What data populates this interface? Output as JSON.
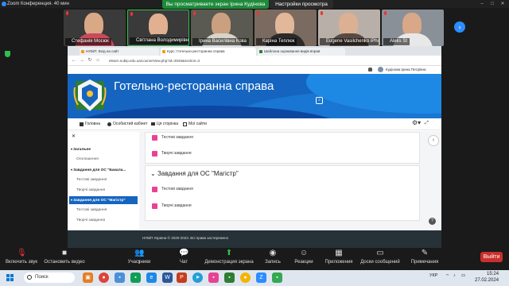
{
  "zoom": {
    "window_title": "Zoom Конференция. 40 мин",
    "share_banner": "Вы просматриваете экран Ірина Кудінова",
    "view_options": "Настройки просмотра"
  },
  "participants": [
    {
      "name": "Стефанія Мосюк",
      "muted": true
    },
    {
      "name": "Світлана Володимирівна",
      "muted": true
    },
    {
      "name": "Ірина Василівна Кова",
      "muted": true
    },
    {
      "name": "Каріна Теплюк",
      "muted": true
    },
    {
      "name": "Eugene Vasilchenko iPho...",
      "muted": true
    },
    {
      "name": "Aleks St",
      "muted": true
    }
  ],
  "browser": {
    "tabs": [
      "НУБіП: Вхід на сайт",
      "Курс: Готельно-ресторанна справа",
      "Шаблони оцінювання видів вправ"
    ],
    "url": "elearn.nubip.edu.ua/course/view.php?id=3545&section=2",
    "user_name": "Кудінова Ірина Петрівна"
  },
  "course": {
    "title": "Готельно-ресторанна справа",
    "nav": [
      "Головна",
      "Особистий кабінет",
      "Ця сторінка",
      "Мої сайти"
    ],
    "drawer": [
      {
        "label": "Загальне",
        "type": "sec"
      },
      {
        "label": "Оголошення",
        "type": "sub"
      },
      {
        "label": "Завдання для ОС \"Бакала...",
        "type": "sec"
      },
      {
        "label": "Тестові завдання",
        "type": "sub"
      },
      {
        "label": "Творчі завдання",
        "type": "sub"
      },
      {
        "label": "Завдання для ОС \"Магістр\"",
        "type": "active"
      },
      {
        "label": "Тестові завдання",
        "type": "sub"
      },
      {
        "label": "Творчі завдання",
        "type": "sub"
      }
    ],
    "activities_top": [
      "Тестові завдання",
      "Творчі завдання"
    ],
    "section_title": "Завдання для ОС \"Магістр\"",
    "activities_bottom": [
      "Тестові завдання",
      "Творчі завдання"
    ],
    "footer": "НУБіП України © 2020-2023. Всі права застережено"
  },
  "toolbar": {
    "items": [
      {
        "label": "Включить звук",
        "icon": "mic-muted-icon"
      },
      {
        "label": "Остановить видео",
        "icon": "video-icon"
      },
      {
        "label": "Участники",
        "icon": "participants-icon",
        "count": "9"
      },
      {
        "label": "Чат",
        "icon": "chat-icon"
      },
      {
        "label": "Демонстрация экрана",
        "icon": "share-screen-icon"
      },
      {
        "label": "Запись",
        "icon": "record-icon"
      },
      {
        "label": "Реакции",
        "icon": "reaction-icon"
      },
      {
        "label": "Приложения",
        "icon": "apps-icon"
      },
      {
        "label": "Доски сообщений",
        "icon": "whiteboard-icon"
      },
      {
        "label": "Примечания",
        "icon": "notes-icon"
      }
    ],
    "leave_label": "Выйти"
  },
  "taskbar": {
    "search_placeholder": "Поиск",
    "language": "УКР",
    "time": "15:24",
    "date": "27.02.2024"
  }
}
